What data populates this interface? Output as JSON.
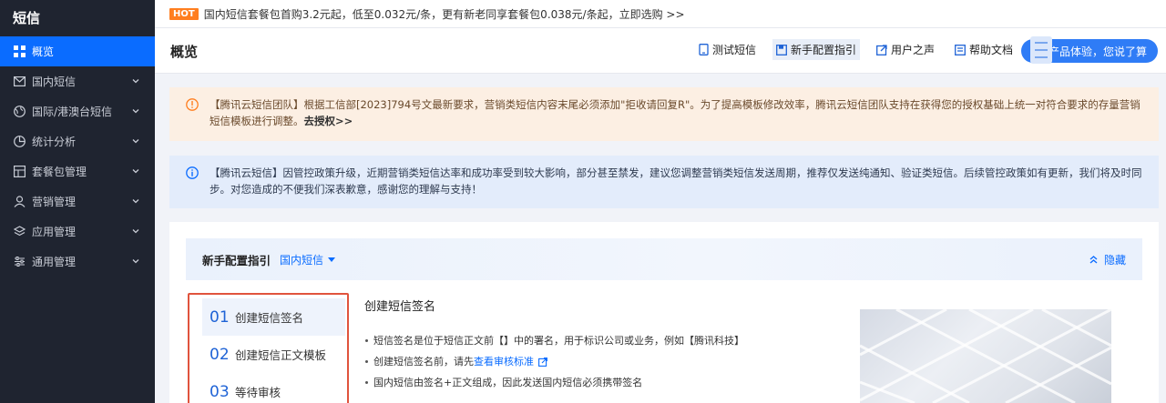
{
  "sidebar": {
    "title": "短信",
    "items": [
      {
        "label": "概览",
        "icon": "grid-icon",
        "active": true
      },
      {
        "label": "国内短信",
        "icon": "mail-icon"
      },
      {
        "label": "国际/港澳台短信",
        "icon": "globe-icon"
      },
      {
        "label": "统计分析",
        "icon": "pie-chart-icon"
      },
      {
        "label": "套餐包管理",
        "icon": "package-icon"
      },
      {
        "label": "营销管理",
        "icon": "user-icon"
      },
      {
        "label": "应用管理",
        "icon": "layers-icon"
      },
      {
        "label": "通用管理",
        "icon": "sliders-icon"
      }
    ]
  },
  "announcement": {
    "badge": "HOT",
    "text": "国内短信套餐包首购3.2元起，低至0.032元/条，更有新老同享套餐包0.038元/条起，立即选购 >>"
  },
  "header": {
    "title": "概览",
    "links": [
      {
        "label": "测试短信",
        "icon": "phone-icon"
      },
      {
        "label": "新手配置指引",
        "icon": "book-icon",
        "selected": true
      },
      {
        "label": "用户之声",
        "icon": "external-link-icon"
      },
      {
        "label": "帮助文档",
        "icon": "doc-icon"
      }
    ],
    "feedback_label": "产品体验，您说了算"
  },
  "notices": {
    "warning": {
      "text": "【腾讯云短信团队】根据工信部[2023]794号文最新要求，营销类短信内容末尾必须添加\"拒收请回复R\"。为了提高模板修改效率，腾讯云短信团队支持在获得您的授权基础上统一对符合要求的存量营销短信模板进行调整。",
      "link": "去授权>>"
    },
    "info": {
      "text": "【腾讯云短信】因管控政策升级，近期营销类短信达率和成功率受到较大影响，部分甚至禁发，建议您调整营销类短信发送周期，推荐仅发送纯通知、验证类短信。后续管控政策如有更新，我们将及时同步。对您造成的不便我们深表歉意，感谢您的理解与支持！"
    }
  },
  "guide": {
    "title": "新手配置指引",
    "tag": "国内短信",
    "hide_label": "隐藏",
    "steps": [
      {
        "num": "01",
        "label": "创建短信签名",
        "active": true
      },
      {
        "num": "02",
        "label": "创建短信正文模板"
      },
      {
        "num": "03",
        "label": "等待审核"
      }
    ],
    "detail": {
      "title": "创建短信签名",
      "bullet1": "短信签名是位于短信正文前【】中的署名，用于标识公司或业务，例如【腾讯科技】",
      "bullet2_prefix": "创建短信签名前，请先",
      "bullet2_link": "查看审核标准",
      "bullet3": "国内短信由签名+正文组成，因此发送国内短信必须携带签名"
    }
  },
  "colors": {
    "sidebar_bg": "#1f2430",
    "accent": "#0a6cff",
    "hot": "#ff7e1f",
    "warn_bg": "#fcefe3",
    "info_bg": "#e3ecfb",
    "highlight_border": "#e0533d"
  }
}
